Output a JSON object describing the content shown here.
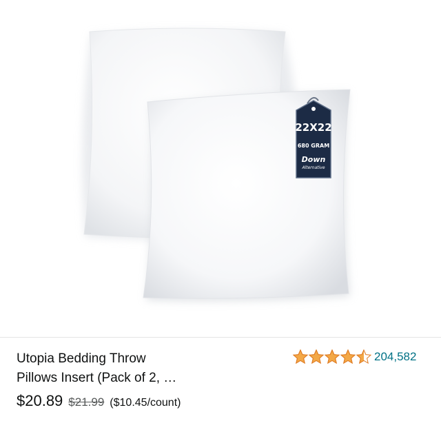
{
  "product": {
    "image": {
      "tag_size": "22X22",
      "tag_weight": "680 GRAM",
      "tag_brand_line1": "Down",
      "tag_brand_line2": "Alternative"
    },
    "title_line1": "Utopia Bedding Throw",
    "title_line2": "Pillows Insert (Pack of 2, …",
    "rating_stars": 4.5,
    "review_count": "204,582",
    "price_current": "$20.89",
    "price_list": "$21.99",
    "price_per_unit": "($10.45/count)"
  },
  "colors": {
    "star": "#f3a847",
    "star_outline": "#de7921",
    "link": "#007185",
    "tag_navy": "#1c2b45"
  },
  "icons": {
    "stars": "star-rating-icon",
    "tag": "product-tag-icon"
  }
}
